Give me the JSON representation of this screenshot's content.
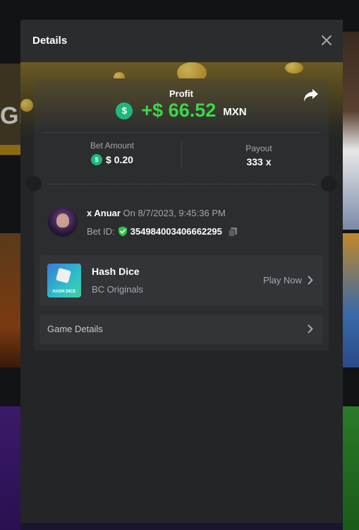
{
  "modal": {
    "title": "Details"
  },
  "profit": {
    "label": "Profit",
    "amount": "+$ 66.52",
    "currency": "MXN",
    "coin_symbol": "$"
  },
  "stats": {
    "bet_amount_label": "Bet Amount",
    "bet_amount_value": "$ 0.20",
    "payout_label": "Payout",
    "payout_value": "333 x"
  },
  "user": {
    "name": "x Anuar",
    "date": "On 8/7/2023, 9:45:36 PM",
    "bet_id_label": "Bet ID:",
    "bet_id_value": "354984003406662295"
  },
  "game": {
    "name": "Hash Dice",
    "provider": "BC Originals",
    "play_label": "Play Now",
    "thumb_text": "HASH DICE"
  },
  "game_details": {
    "label": "Game Details"
  },
  "background": {
    "side_text": "GR"
  },
  "colors": {
    "accent_green": "#3bd64a",
    "coin_green": "#1fb87a",
    "modal_bg": "#232527"
  }
}
